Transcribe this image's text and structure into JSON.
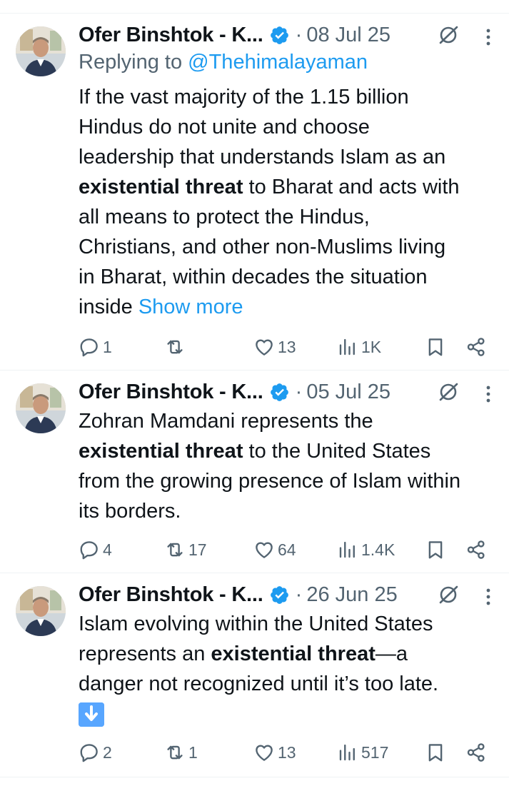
{
  "tweets": [
    {
      "name": "Ofer Binshtok - K...",
      "separator": "·",
      "date": "08 Jul 25",
      "reply_prefix": "Replying to",
      "reply_handle": "@Thehimalayaman",
      "lines": [
        [
          "If the vast majority of the 1.15 billion"
        ],
        [
          "Hindus do not unite and choose"
        ],
        [
          "leadership that understands Islam as an"
        ],
        [
          "existential threat",
          " to Bharat and acts with"
        ],
        [
          "all means to protect the Hindus,"
        ],
        [
          "Christians, and other non-Muslims living"
        ],
        [
          "in Bharat, within decades the situation"
        ],
        [
          "inside ",
          "Show more"
        ]
      ],
      "stats": {
        "replies": "1",
        "reposts": "",
        "likes": "13",
        "views": "1K"
      }
    },
    {
      "name": "Ofer Binshtok - K...",
      "separator": "·",
      "date": "05 Jul 25",
      "lines": [
        [
          "Zohran Mamdani represents the"
        ],
        [
          "existential threat",
          " to the United States"
        ],
        [
          "from the growing presence of Islam within"
        ],
        [
          "its borders."
        ]
      ],
      "stats": {
        "replies": "4",
        "reposts": "17",
        "likes": "64",
        "views": "1.4K"
      }
    },
    {
      "name": "Ofer Binshtok - K...",
      "separator": "·",
      "date": "26 Jun 25",
      "lines": [
        [
          "Islam evolving within the United States"
        ],
        [
          "represents an ",
          "existential threat",
          "—a"
        ],
        [
          "danger not recognized until it’s too late."
        ]
      ],
      "emoji": "down-arrow-emoji",
      "stats": {
        "replies": "2",
        "reposts": "1",
        "likes": "13",
        "views": "517"
      }
    }
  ],
  "colors": {
    "accent": "#1d9bf0",
    "muted": "#536471",
    "text": "#0f1419",
    "divider": "#eff3f4"
  }
}
